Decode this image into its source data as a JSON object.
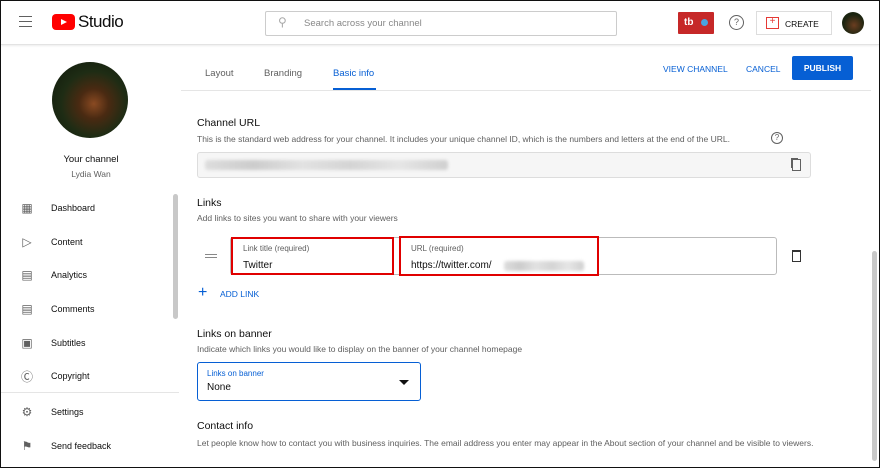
{
  "header": {
    "logo_text": "Studio",
    "search_placeholder": "Search across your channel",
    "tb_badge": "tb",
    "create_label": "CREATE"
  },
  "sidebar": {
    "channel_label": "Your channel",
    "channel_name": "Lydia Wan",
    "items": [
      {
        "label": "Dashboard",
        "icon": "dashboard-icon"
      },
      {
        "label": "Content",
        "icon": "content-icon"
      },
      {
        "label": "Analytics",
        "icon": "analytics-icon"
      },
      {
        "label": "Comments",
        "icon": "comments-icon"
      },
      {
        "label": "Subtitles",
        "icon": "subtitles-icon"
      },
      {
        "label": "Copyright",
        "icon": "copyright-icon"
      }
    ],
    "bottom": [
      {
        "label": "Settings",
        "icon": "gear-icon"
      },
      {
        "label": "Send feedback",
        "icon": "feedback-icon"
      }
    ]
  },
  "tabs": [
    {
      "label": "Layout"
    },
    {
      "label": "Branding"
    },
    {
      "label": "Basic info",
      "active": true
    }
  ],
  "actions": {
    "view_channel": "VIEW CHANNEL",
    "cancel": "CANCEL",
    "publish": "PUBLISH"
  },
  "channel_url": {
    "title": "Channel URL",
    "desc": "This is the standard web address for your channel. It includes your unique channel ID, which is the numbers and letters at the end of the URL."
  },
  "links": {
    "title": "Links",
    "desc": "Add links to sites you want to share with your viewers",
    "link_title_label": "Link title (required)",
    "link_title_value": "Twitter",
    "url_label": "URL (required)",
    "url_value": "https://twitter.com/",
    "add_link": "ADD LINK"
  },
  "banner": {
    "title": "Links on banner",
    "desc": "Indicate which links you would like to display on the banner of your channel homepage",
    "select_label": "Links on banner",
    "select_value": "None"
  },
  "contact": {
    "title": "Contact info",
    "desc": "Let people know how to contact you with business inquiries. The email address you enter may appear in the About section of your channel and be visible to viewers."
  },
  "colors": {
    "accent": "#065fd4",
    "highlight": "#e00000",
    "brand": "#ff0000"
  }
}
